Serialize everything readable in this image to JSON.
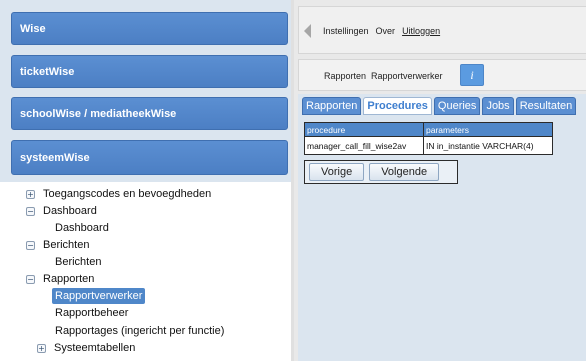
{
  "left": {
    "apps": [
      "Wise",
      "ticketWise",
      "schoolWise / mediatheekWise",
      "systeemWise"
    ],
    "tree": {
      "toegangscodes": "Toegangscodes en bevoegdheden",
      "dashboard": "Dashboard",
      "dashboard_child": "Dashboard",
      "berichten": "Berichten",
      "berichten_child": "Berichten",
      "rapporten": "Rapporten",
      "rapportverwerker": "Rapportverwerker",
      "rapportbeheer": "Rapportbeheer",
      "rapportages": "Rapportages (ingericht per functie)",
      "systeemtabellen": "Systeemtabellen"
    }
  },
  "topbar": {
    "instellingen": "Instellingen",
    "over": "Over",
    "uitloggen": "Uitloggen"
  },
  "subbar": {
    "rapporten": "Rapporten",
    "rapportverwerker": "Rapportverwerker",
    "info": "i"
  },
  "tabs": [
    "Rapporten",
    "Procedures",
    "Queries",
    "Jobs",
    "Resultaten"
  ],
  "table": {
    "headers": [
      "procedure",
      "parameters"
    ],
    "rows": [
      [
        "manager_call_fill_wise2av",
        "IN in_instantie VARCHAR(4)"
      ]
    ]
  },
  "pager": {
    "prev": "Vorige",
    "next": "Volgende"
  }
}
